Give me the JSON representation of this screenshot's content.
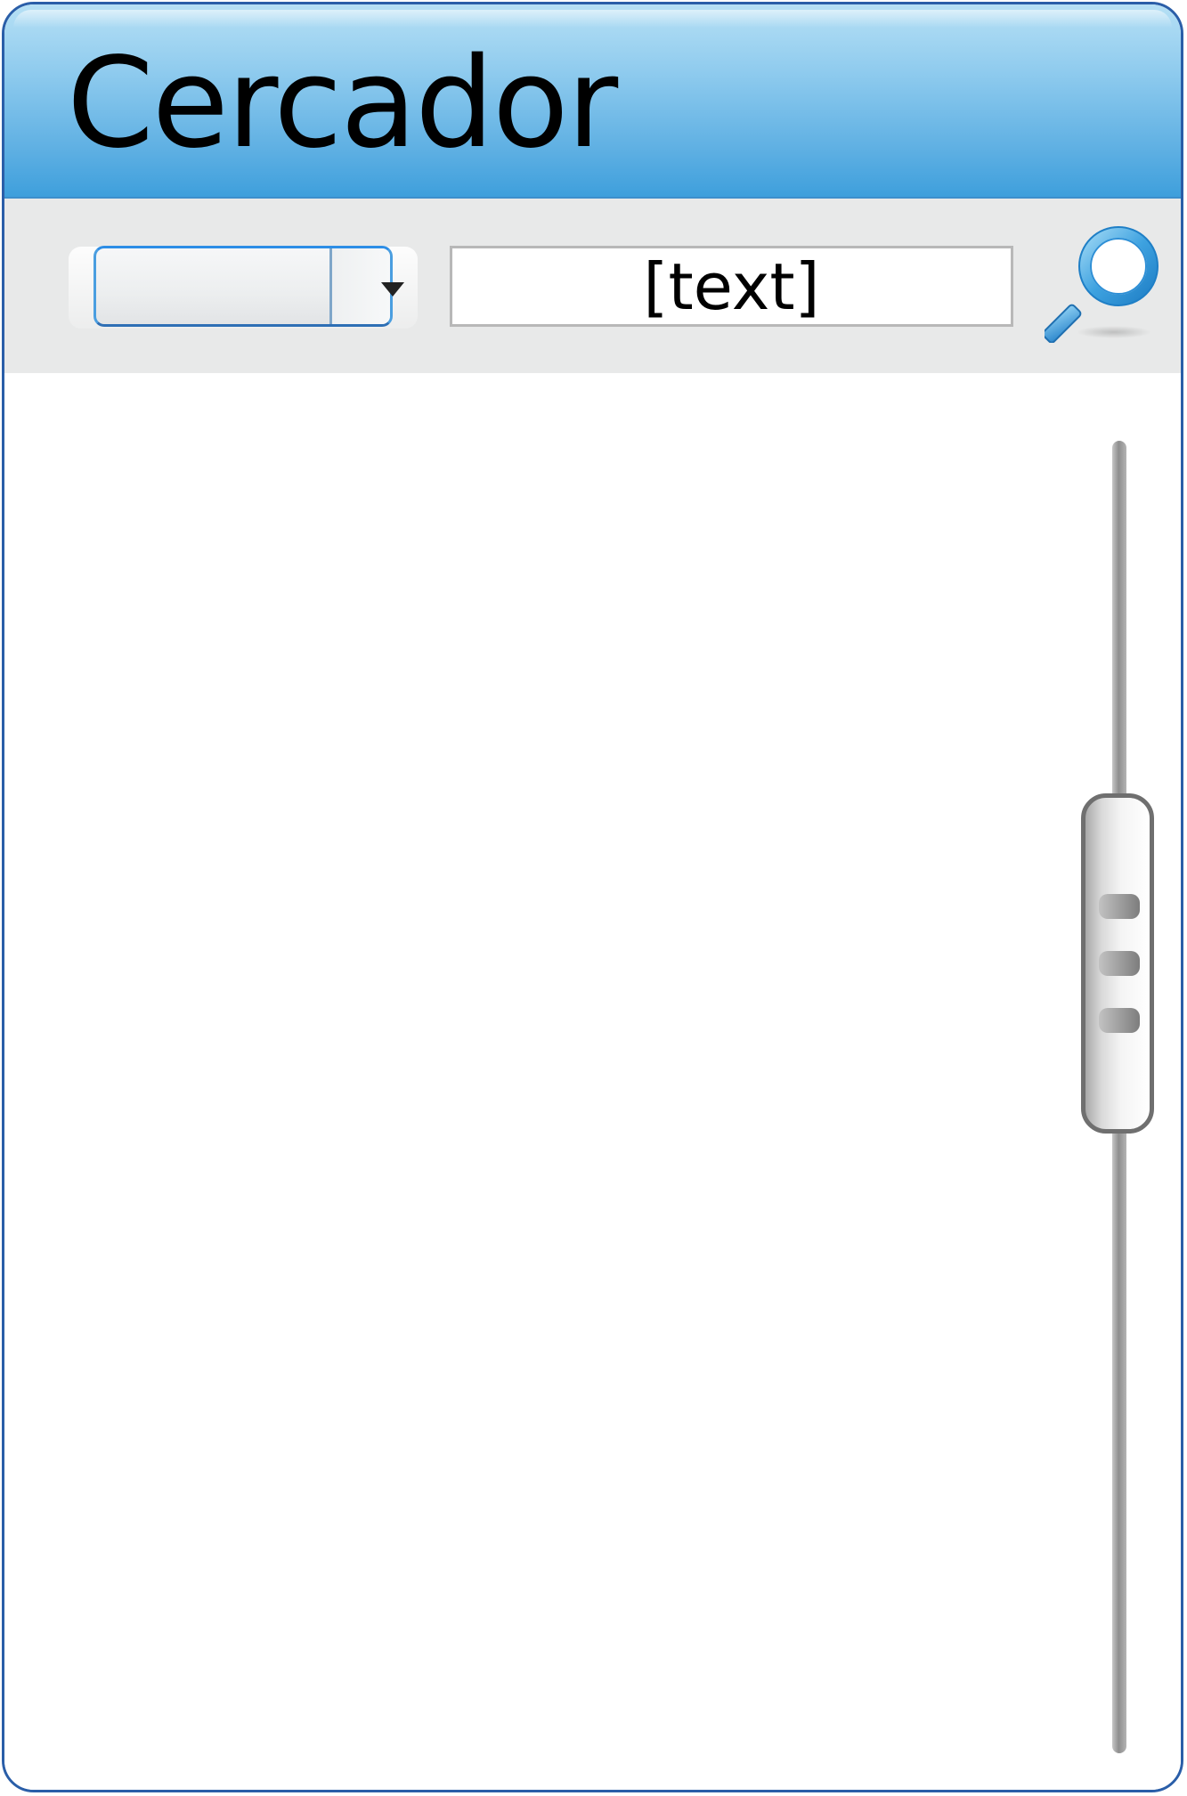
{
  "window": {
    "title": "Cercador"
  },
  "toolbar": {
    "dropdown": {
      "selected_value": "",
      "icon": "chevron-down-icon"
    },
    "search": {
      "value": "[text]",
      "placeholder": ""
    },
    "search_button": {
      "icon": "search-icon"
    }
  },
  "scrollbar": {
    "thumb_position": 0.33,
    "thumb_size_fraction": 0.26
  },
  "colors": {
    "title_bar": "#5fb0e3",
    "window_border": "#2a5ea8",
    "toolbar_bg": "#e8e9e9",
    "accent": "#3e9fdc"
  }
}
